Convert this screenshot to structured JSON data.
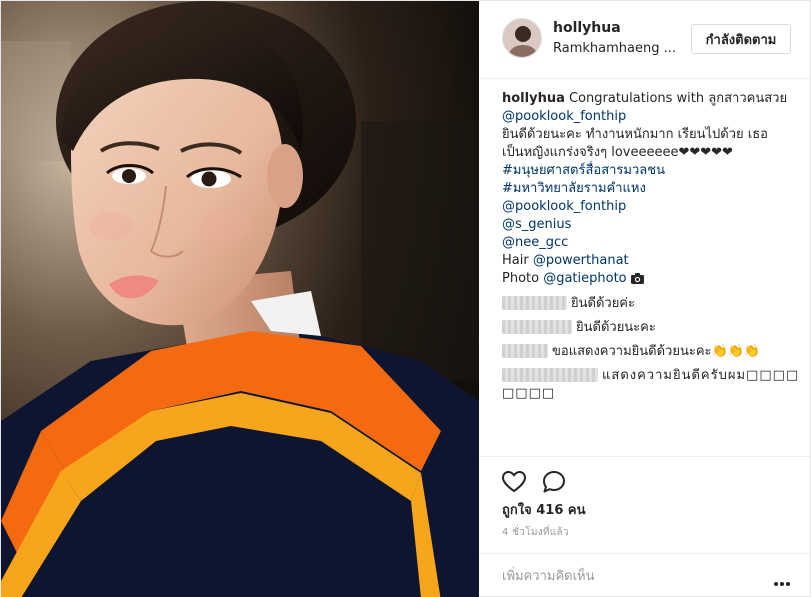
{
  "post": {
    "photo_description_icon": "portrait-photo"
  },
  "header": {
    "username": "hollyhua",
    "location": "Ramkhamhaeng ...",
    "follow_label": "กำลังติดตาม"
  },
  "caption": {
    "author": "hollyhua",
    "line1_text": " Congratulations with ลูกสาวคนสวย",
    "mention1": "@pooklook_fonthip",
    "line3": "ยินดีด้วยนะคะ ทำงานหนักมาก เรียนไปด้วย เธอ",
    "line4": "เป็นหญิงแกร่งจริงๆ loveeeeee❤❤❤❤❤",
    "hashtag1": "#มนุษยศาสตร์สื่อสารมวลชน",
    "hashtag2": "#มหาวิทยาลัยรามคำแหง",
    "mention2": "@pooklook_fonthip",
    "mention3": "@s_genius",
    "mention4": "@nee_gcc",
    "hair_label": "Hair ",
    "hair_mention": "@powerthanat",
    "photo_label": "Photo ",
    "photo_mention": "@gatiephoto"
  },
  "comments": [
    {
      "text": "ยินดีด้วยค่ะ"
    },
    {
      "text": "ยินดีด้วยนะคะ"
    },
    {
      "text": "ขอแสดงความยินดีด้วยนะคะ👏👏👏"
    },
    {
      "text": "แสดงความยินดีครับผม□□□□",
      "text2": "□□□□"
    }
  ],
  "stats": {
    "likes": "ถูกใจ 416 คน",
    "time_ago": "4 ชั่วโมงที่แล้ว"
  },
  "add_comment": {
    "placeholder": "เพิ่มความคิดเห็น"
  },
  "colors": {
    "link": "#003569",
    "gown": "#0d1530",
    "sash_orange": "#f46a10",
    "sash_gold": "#f7a51c"
  }
}
